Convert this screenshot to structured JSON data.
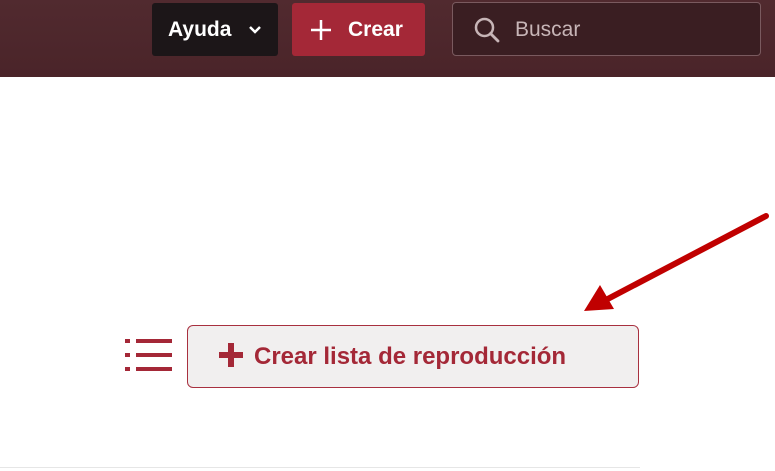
{
  "header": {
    "help_label": "Ayuda",
    "create_label": "Crear",
    "search": {
      "placeholder": "Buscar",
      "value": ""
    }
  },
  "main": {
    "create_playlist_label": "Crear lista de reproducción"
  },
  "icons": {
    "help_chevron": "chevron-down-icon",
    "create_plus": "plus-icon",
    "search": "search-icon",
    "list": "list-icon",
    "playlist_plus": "plus-icon",
    "annotation": "red-arrow-annotation"
  },
  "colors": {
    "header_bg": "#4e282d",
    "help_bg": "#1c1618",
    "accent": "#a42837",
    "button_bg": "#f1efef",
    "annotation_arrow": "#c00000"
  }
}
